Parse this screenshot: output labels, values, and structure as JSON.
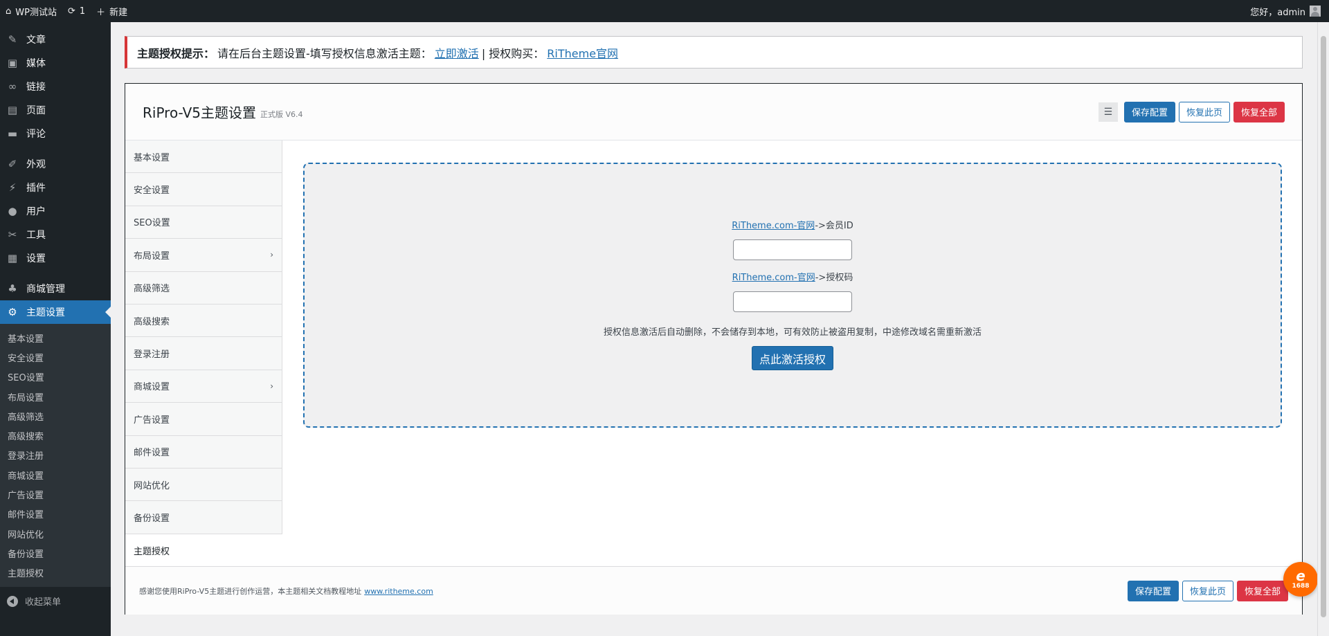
{
  "admin_bar": {
    "site_name": "WP测试站",
    "updates_count": "1",
    "new_label": "新建",
    "greeting": "您好，admin"
  },
  "sidebar": {
    "items": [
      {
        "label": "文章",
        "icon": "pin-icon"
      },
      {
        "label": "媒体",
        "icon": "media-icon"
      },
      {
        "label": "链接",
        "icon": "link-icon"
      },
      {
        "label": "页面",
        "icon": "page-icon"
      },
      {
        "label": "评论",
        "icon": "comment-icon"
      },
      {
        "label": "外观",
        "icon": "brush-icon"
      },
      {
        "label": "插件",
        "icon": "plugin-icon"
      },
      {
        "label": "用户",
        "icon": "user-icon"
      },
      {
        "label": "工具",
        "icon": "wrench-icon"
      },
      {
        "label": "设置",
        "icon": "settings-icon"
      },
      {
        "label": "商城管理",
        "icon": "shop-icon"
      },
      {
        "label": "主题设置",
        "icon": "gear-icon"
      }
    ],
    "submenu": [
      "基本设置",
      "安全设置",
      "SEO设置",
      "布局设置",
      "高级筛选",
      "高级搜索",
      "登录注册",
      "商城设置",
      "广告设置",
      "邮件设置",
      "网站优化",
      "备份设置",
      "主题授权"
    ],
    "collapse_label": "收起菜单"
  },
  "notice": {
    "title": "主题授权提示：",
    "text": "请在后台主题设置-填写授权信息激活主题：",
    "activate_link": "立即激活",
    "separator": "| 授权购买：",
    "buy_link": "RiTheme官网"
  },
  "panel": {
    "title": "RiPro-V5主题设置",
    "version": "正式版 V6.4",
    "save_label": "保存配置",
    "reset_page_label": "恢复此页",
    "reset_all_label": "恢复全部",
    "nav": [
      {
        "label": "基本设置",
        "has_sub": false
      },
      {
        "label": "安全设置",
        "has_sub": false
      },
      {
        "label": "SEO设置",
        "has_sub": false
      },
      {
        "label": "布局设置",
        "has_sub": true
      },
      {
        "label": "高级筛选",
        "has_sub": false
      },
      {
        "label": "高级搜索",
        "has_sub": false
      },
      {
        "label": "登录注册",
        "has_sub": false
      },
      {
        "label": "商城设置",
        "has_sub": true
      },
      {
        "label": "广告设置",
        "has_sub": false
      },
      {
        "label": "邮件设置",
        "has_sub": false
      },
      {
        "label": "网站优化",
        "has_sub": false
      },
      {
        "label": "备份设置",
        "has_sub": false
      },
      {
        "label": "主题授权",
        "has_sub": false
      }
    ],
    "license": {
      "member_link": "RiTheme.com-官网",
      "member_suffix": "->会员ID",
      "member_value": "",
      "code_link": "RiTheme.com-官网",
      "code_suffix": "->授权码",
      "code_value": "",
      "hint": "授权信息激活后自动删除，不会储存到本地，可有效防止被盗用复制，中途修改域名需重新激活",
      "activate_label": "点此激活授权"
    },
    "footer": {
      "text": "感谢您使用RiPro-V5主题进行创作运营，本主题相关文档教程地址",
      "link": "www.ritheme.com"
    }
  },
  "fab": {
    "label": "1688"
  },
  "colors": {
    "accent": "#2271b1",
    "danger": "#dc3545",
    "adminbar": "#1d2327",
    "notice_border": "#d63638"
  }
}
